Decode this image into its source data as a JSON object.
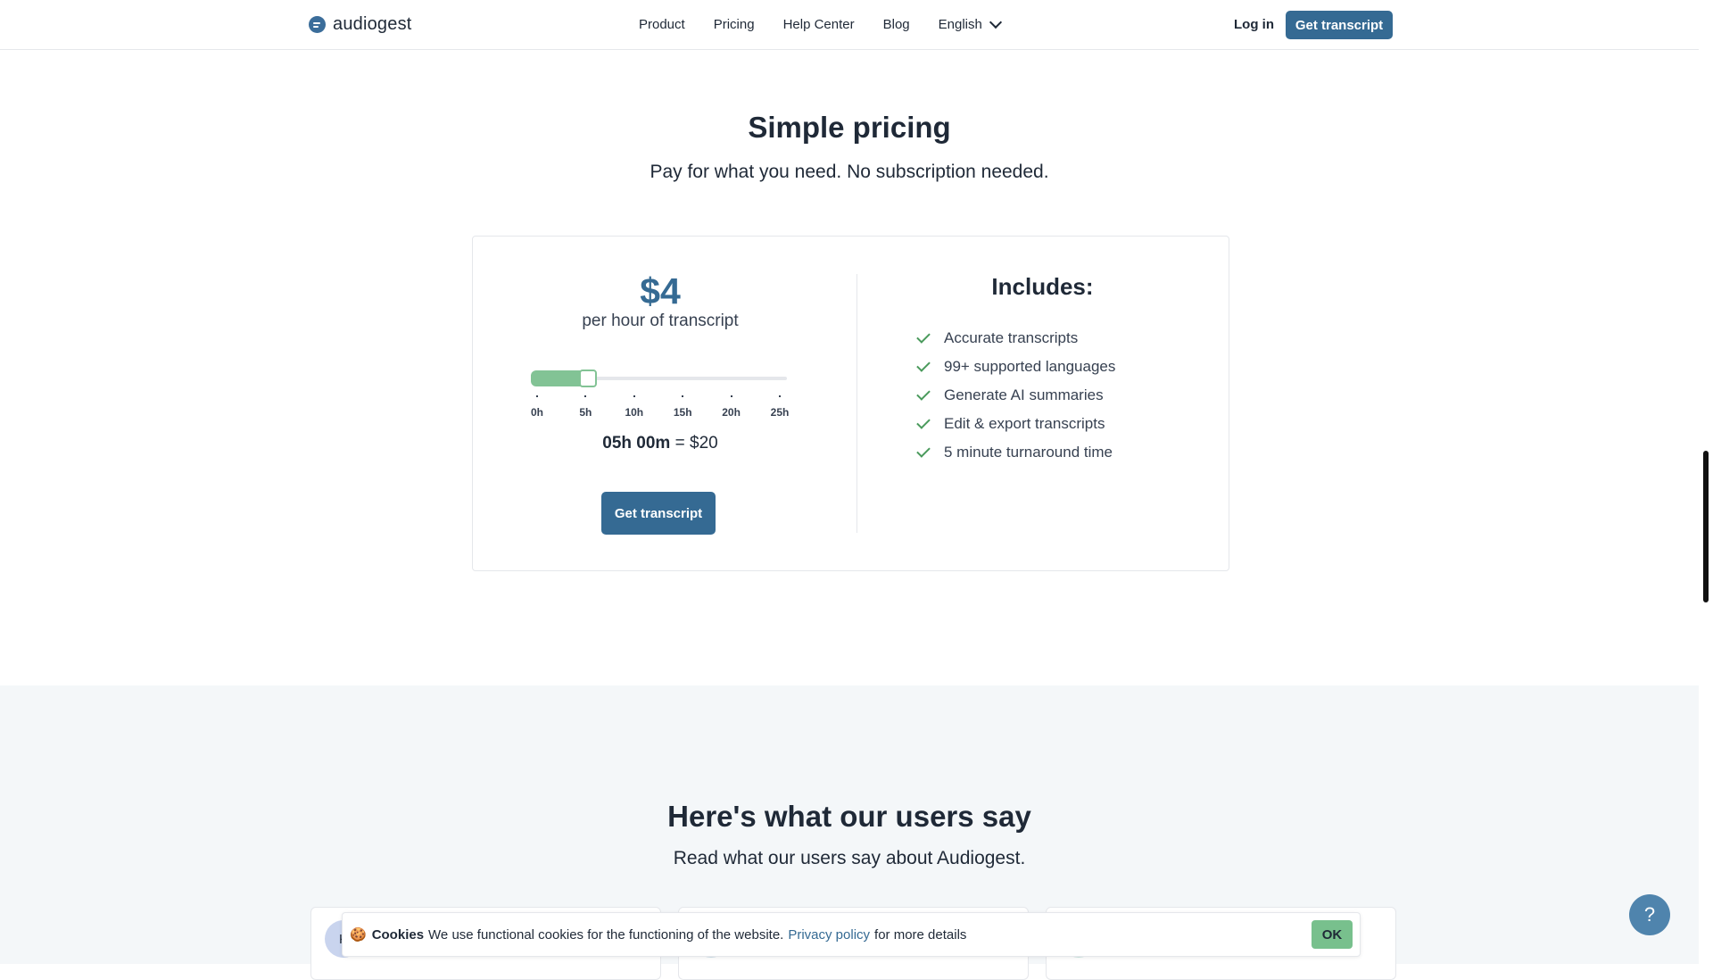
{
  "brand": {
    "name": "audiogest"
  },
  "nav": {
    "items": [
      "Product",
      "Pricing",
      "Help Center",
      "Blog"
    ],
    "language": "English",
    "login": "Log in",
    "cta": "Get transcript"
  },
  "pricing": {
    "title": "Simple pricing",
    "subtitle": "Pay for what you need. No subscription needed.",
    "price": "$4",
    "unit": "per hour of transcript",
    "slider": {
      "ticks": [
        "0h",
        "5h",
        "10h",
        "15h",
        "20h",
        "25h"
      ],
      "value_hours": 5,
      "max_hours": 25
    },
    "summary_time": "05h 00m",
    "summary_eq": "=",
    "summary_cost": "$20",
    "button": "Get transcript",
    "includes_title": "Includes:",
    "features": [
      "Accurate transcripts",
      "99+ supported languages",
      "Generate AI summaries",
      "Edit & export transcripts",
      "5 minute turnaround time"
    ]
  },
  "testimonials": {
    "title": "Here's what our users say",
    "subtitle": "Read what our users say about Audiogest.",
    "first_avatar_initial": "K"
  },
  "cookie": {
    "emoji": "🍪",
    "title": "Cookies",
    "text": "We use functional cookies for the functioning of the website.",
    "link": "Privacy policy",
    "suffix": "for more details",
    "ok": "OK"
  },
  "help": {
    "label": "?"
  },
  "colors": {
    "primary": "#356a93",
    "accent_green": "#82c395",
    "section_bg": "#f4f7f9"
  }
}
